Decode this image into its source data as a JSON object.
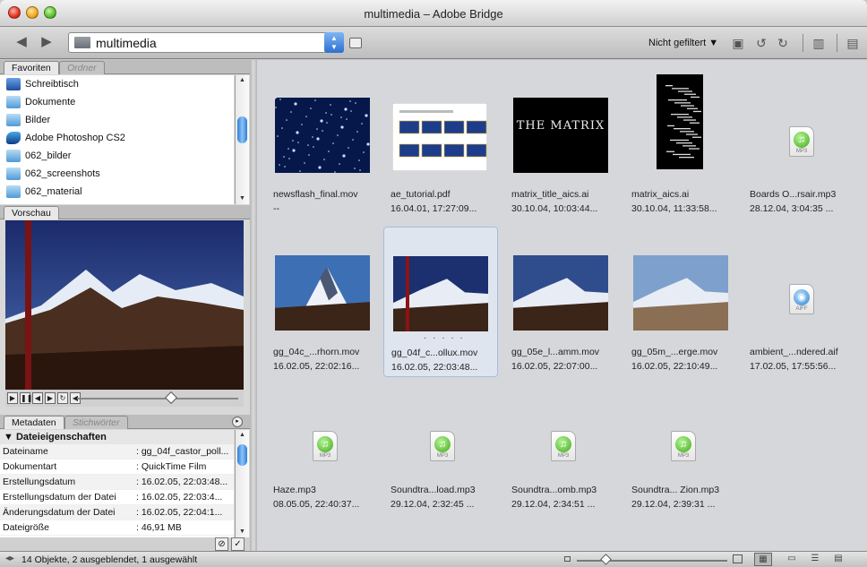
{
  "window": {
    "title": "multimedia – Adobe Bridge"
  },
  "toolbar": {
    "path": "multimedia",
    "filter_label": "Nicht gefiltert ▼",
    "back_icon": "back-arrow-icon",
    "forward_icon": "forward-arrow-icon"
  },
  "favorites": {
    "tabs": [
      "Favoriten",
      "Ordner"
    ],
    "items": [
      {
        "label": "Schreibtisch",
        "icon": "desktop-icon"
      },
      {
        "label": "Dokumente",
        "icon": "folder-icon"
      },
      {
        "label": "Bilder",
        "icon": "folder-icon"
      },
      {
        "label": "Adobe Photoshop CS2",
        "icon": "photoshop-icon"
      },
      {
        "label": "062_bilder",
        "icon": "folder-icon"
      },
      {
        "label": "062_screenshots",
        "icon": "folder-icon"
      },
      {
        "label": "062_material",
        "icon": "folder-icon"
      }
    ]
  },
  "preview": {
    "tab": "Vorschau"
  },
  "metadata": {
    "tabs": [
      "Metadaten",
      "Stichwörter"
    ],
    "section": "▼ Dateieigenschaften",
    "rows": [
      {
        "key": "Dateiname",
        "value": ": gg_04f_castor_poll..."
      },
      {
        "key": "Dokumentart",
        "value": ": QuickTime Film"
      },
      {
        "key": "Erstellungsdatum",
        "value": ": 16.02.05, 22:03:48..."
      },
      {
        "key": "Erstellungsdatum der Datei",
        "value": ": 16.02.05, 22:03:4..."
      },
      {
        "key": "Änderungsdatum der Datei",
        "value": ": 16.02.05, 22:04:1..."
      },
      {
        "key": "Dateigröße",
        "value": ": 46,91 MB"
      }
    ]
  },
  "files": [
    {
      "name": "newsflash_final.mov",
      "date": "--",
      "kind": "stars-image"
    },
    {
      "name": "ae_tutorial.pdf",
      "date": "16.04.01, 17:27:09...",
      "kind": "pdf"
    },
    {
      "name": "matrix_title_aics.ai",
      "date": "30.10.04, 10:03:44...",
      "kind": "matrix-title"
    },
    {
      "name": "matrix_aics.ai",
      "date": "30.10.04, 11:33:58...",
      "kind": "matrix-code"
    },
    {
      "name": "Boards O...rsair.mp3",
      "date": "28.12.04, 3:04:35 ...",
      "kind": "mp3"
    },
    {
      "name": "gg_04c_...rhorn.mov",
      "date": "16.02.05, 22:02:16...",
      "kind": "mountain1"
    },
    {
      "name": "gg_04f_c...ollux.mov",
      "date": "16.02.05, 22:03:48...",
      "kind": "mountain2",
      "selected": true,
      "rating": "· · · · ·"
    },
    {
      "name": "gg_05e_l...amm.mov",
      "date": "16.02.05, 22:07:00...",
      "kind": "mountain3"
    },
    {
      "name": "gg_05m_...erge.mov",
      "date": "16.02.05, 22:10:49...",
      "kind": "mountain4"
    },
    {
      "name": "ambient_...ndered.aif",
      "date": "17.02.05, 17:55:56...",
      "kind": "aiff"
    },
    {
      "name": "Haze.mp3",
      "date": "08.05.05, 22:40:37...",
      "kind": "mp3"
    },
    {
      "name": "Soundtra...load.mp3",
      "date": "29.12.04, 2:32:45 ...",
      "kind": "mp3"
    },
    {
      "name": "Soundtra...omb.mp3",
      "date": "29.12.04, 2:34:51 ...",
      "kind": "mp3"
    },
    {
      "name": "Soundtra... Zion.mp3",
      "date": "29.12.04, 2:39:31 ...",
      "kind": "mp3"
    }
  ],
  "matrix_title": "THE MATRIX",
  "icon_labels": {
    "mp3": "MP3",
    "aiff": "AIFF"
  },
  "status": {
    "text": "14 Objekte, 2 ausgeblendet, 1 ausgewählt"
  }
}
